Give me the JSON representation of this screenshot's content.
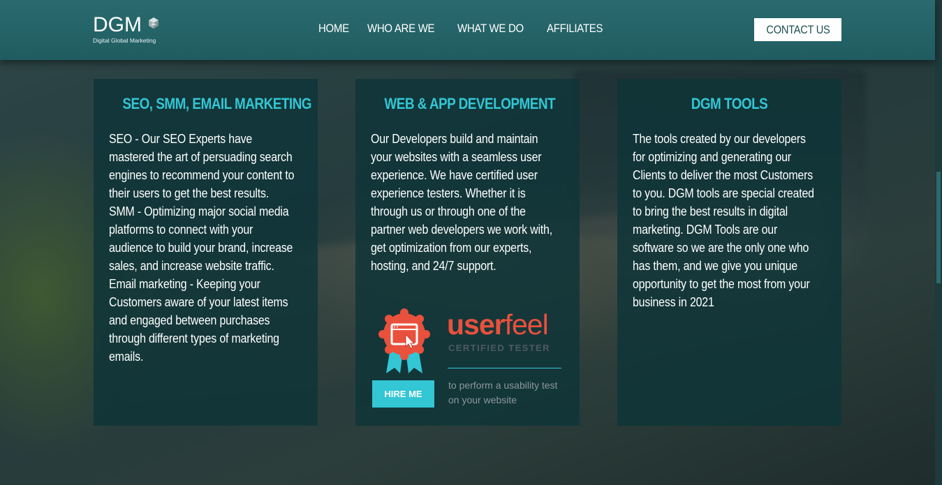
{
  "brand": {
    "name": "DGM",
    "tagline": "Digital Global Marketing"
  },
  "nav": {
    "items": [
      {
        "label": "HOME"
      },
      {
        "label": "WHO ARE WE"
      },
      {
        "label": "WHAT WE DO"
      },
      {
        "label": "AFFILIATES"
      }
    ],
    "contact_label": "CONTACT US"
  },
  "cards": [
    {
      "title": "SEO, SMM, EMAIL MARKETING",
      "paragraphs": [
        "SEO - Our SEO Experts have mastered the art of persuading search engines to recommend your content to their users to get the best results.",
        "SMM - Optimizing major social media platforms to connect with your audience to build your brand, increase sales, and increase website traffic.",
        "Email marketing - Keeping your Customers aware of your latest items and engaged between purchases through different types of marketing emails."
      ]
    },
    {
      "title": "WEB & APP DEVELOPMENT",
      "paragraphs": [
        "Our Developers build and maintain your websites with a seamless user experience. We have certified user experience testers. Whether it is through us or through one of the partner web developers we work with, get optimization from our experts, hosting, and 24/7 support."
      ],
      "badge": {
        "brand_bold": "user",
        "brand_light": "feel",
        "subtitle": "CERTIFIED TESTER",
        "button_label": "HIRE ME",
        "note": "to perform a usability test on your website",
        "accent": "#e9513d",
        "button_color": "#33c6d4"
      }
    },
    {
      "title": "DGM TOOLS",
      "paragraphs": [
        "The tools created by our developers for optimizing and generating our Clients to deliver the most Customers to you. DGM tools are special created to bring the best results in digital marketing. DGM Tools are our software so we are the only one who has them, and we give you unique opportunity to get the most from your business in 2021"
      ]
    }
  ],
  "colors": {
    "header": "#236568",
    "card_title": "#33c6d4",
    "card_bg": "#0e3438"
  }
}
